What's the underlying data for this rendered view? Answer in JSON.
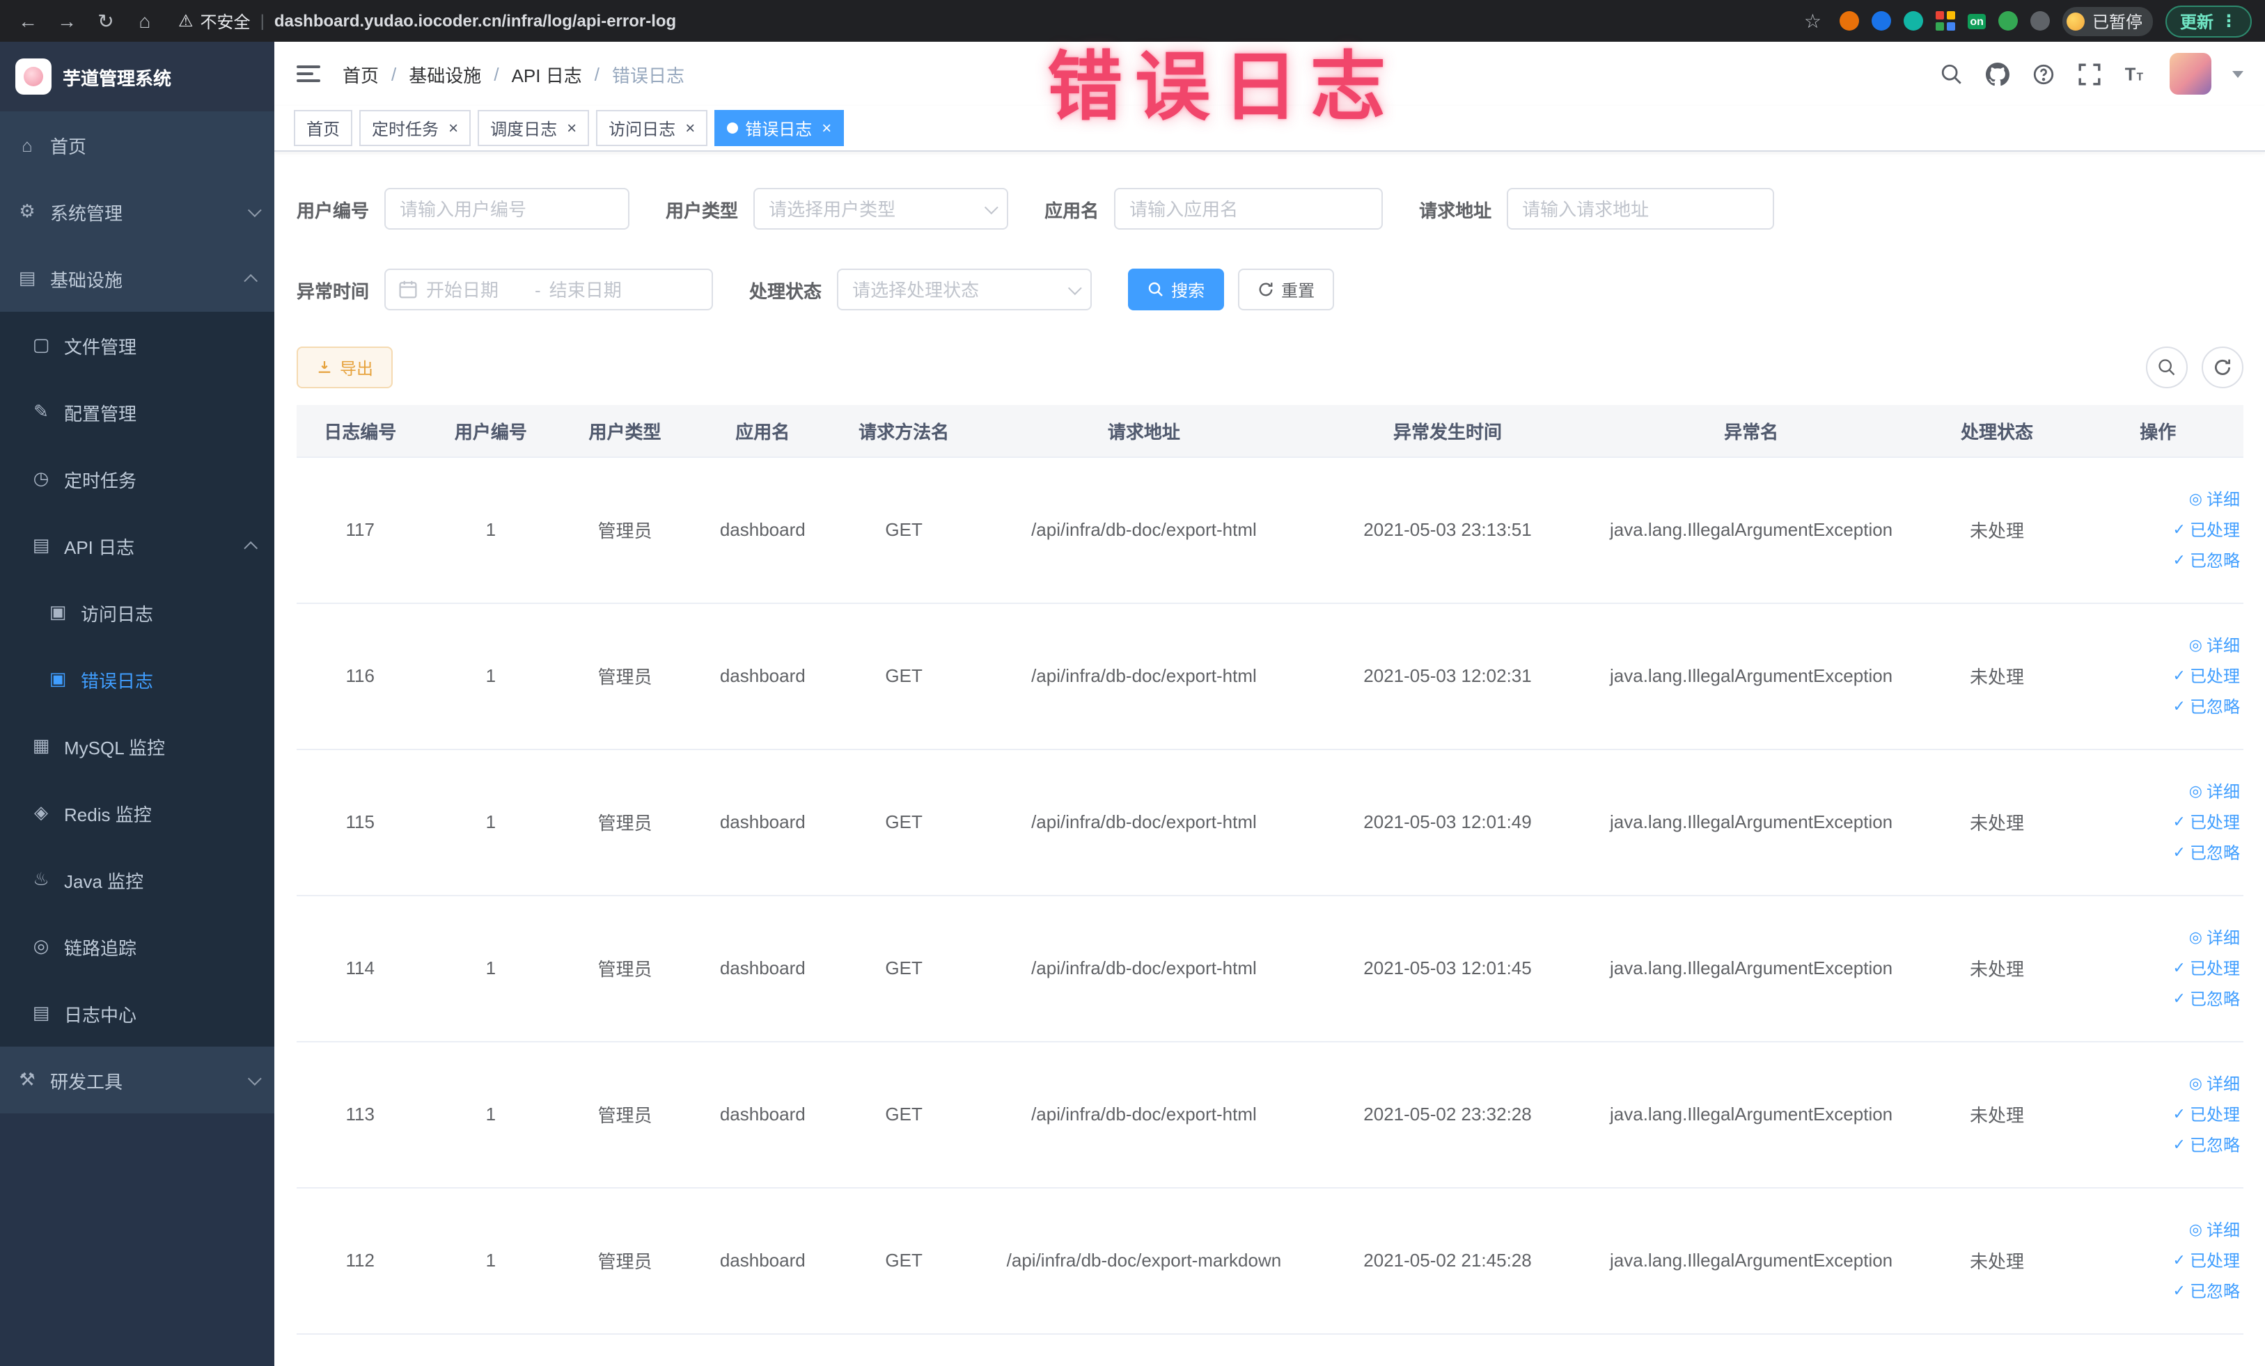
{
  "annotation": {
    "text": "错误日志"
  },
  "icons": {
    "back": "←",
    "forward": "→",
    "reload": "↻",
    "home": "⌂",
    "warning": "⚠",
    "star": "☆",
    "dots": "⋮",
    "close": "×",
    "check": "✓",
    "eye": "◎",
    "menu_home": "⌂",
    "menu_system": "⚙",
    "menu_infra": "▤",
    "menu_file": "▢",
    "menu_config": "✎",
    "menu_job": "◷",
    "menu_apilog": "▤",
    "menu_access": "▣",
    "menu_error": "▣",
    "menu_mysql": "▦",
    "menu_redis": "◈",
    "menu_java": "♨",
    "menu_trace": "◎",
    "menu_logcenter": "▤",
    "menu_devtool": "⚒",
    "on_badge": "on"
  },
  "browser": {
    "security_label": "不安全",
    "url": "dashboard.yudao.iocoder.cn/infra/log/api-error-log",
    "paused_label": "已暂停",
    "update_label": "更新"
  },
  "sidebar": {
    "logo_title": "芋道管理系统",
    "items": [
      {
        "label": "首页"
      },
      {
        "label": "系统管理"
      },
      {
        "label": "基础设施"
      },
      {
        "label": "文件管理"
      },
      {
        "label": "配置管理"
      },
      {
        "label": "定时任务"
      },
      {
        "label": "API 日志"
      },
      {
        "label": "访问日志"
      },
      {
        "label": "错误日志"
      },
      {
        "label": "MySQL 监控"
      },
      {
        "label": "Redis 监控"
      },
      {
        "label": "Java 监控"
      },
      {
        "label": "链路追踪"
      },
      {
        "label": "日志中心"
      },
      {
        "label": "研发工具"
      }
    ]
  },
  "navbar": {
    "breadcrumbs": [
      "首页",
      "基础设施",
      "API 日志",
      "错误日志"
    ]
  },
  "tabs": [
    {
      "label": "首页"
    },
    {
      "label": "定时任务"
    },
    {
      "label": "调度日志"
    },
    {
      "label": "访问日志"
    },
    {
      "label": "错误日志"
    }
  ],
  "filters": {
    "user_id_label": "用户编号",
    "user_id_placeholder": "请输入用户编号",
    "user_type_label": "用户类型",
    "user_type_placeholder": "请选择用户类型",
    "app_name_label": "应用名",
    "app_name_placeholder": "请输入应用名",
    "request_url_label": "请求地址",
    "request_url_placeholder": "请输入请求地址",
    "time_label": "异常时间",
    "time_start_placeholder": "开始日期",
    "time_end_placeholder": "结束日期",
    "time_separator": "-",
    "status_label": "处理状态",
    "status_placeholder": "请选择处理状态",
    "search_label": "搜索",
    "reset_label": "重置"
  },
  "toolbar": {
    "export_label": "导出"
  },
  "table": {
    "columns": [
      "日志编号",
      "用户编号",
      "用户类型",
      "应用名",
      "请求方法名",
      "请求地址",
      "异常发生时间",
      "异常名",
      "处理状态",
      "操作"
    ],
    "actions": {
      "detail": "详细",
      "processed": "已处理",
      "ignored": "已忽略"
    },
    "rows": [
      {
        "id": "117",
        "user_id": "1",
        "user_type": "管理员",
        "app": "dashboard",
        "method": "GET",
        "url": "/api/infra/db-doc/export-html",
        "time": "2021-05-03 23:13:51",
        "exception": "java.lang.IllegalArgumentException",
        "status": "未处理"
      },
      {
        "id": "116",
        "user_id": "1",
        "user_type": "管理员",
        "app": "dashboard",
        "method": "GET",
        "url": "/api/infra/db-doc/export-html",
        "time": "2021-05-03 12:02:31",
        "exception": "java.lang.IllegalArgumentException",
        "status": "未处理"
      },
      {
        "id": "115",
        "user_id": "1",
        "user_type": "管理员",
        "app": "dashboard",
        "method": "GET",
        "url": "/api/infra/db-doc/export-html",
        "time": "2021-05-03 12:01:49",
        "exception": "java.lang.IllegalArgumentException",
        "status": "未处理"
      },
      {
        "id": "114",
        "user_id": "1",
        "user_type": "管理员",
        "app": "dashboard",
        "method": "GET",
        "url": "/api/infra/db-doc/export-html",
        "time": "2021-05-03 12:01:45",
        "exception": "java.lang.IllegalArgumentException",
        "status": "未处理"
      },
      {
        "id": "113",
        "user_id": "1",
        "user_type": "管理员",
        "app": "dashboard",
        "method": "GET",
        "url": "/api/infra/db-doc/export-html",
        "time": "2021-05-02 23:32:28",
        "exception": "java.lang.IllegalArgumentException",
        "status": "未处理"
      },
      {
        "id": "112",
        "user_id": "1",
        "user_type": "管理员",
        "app": "dashboard",
        "method": "GET",
        "url": "/api/infra/db-doc/export-markdown",
        "time": "2021-05-02 21:45:28",
        "exception": "java.lang.IllegalArgumentException",
        "status": "未处理"
      }
    ]
  }
}
